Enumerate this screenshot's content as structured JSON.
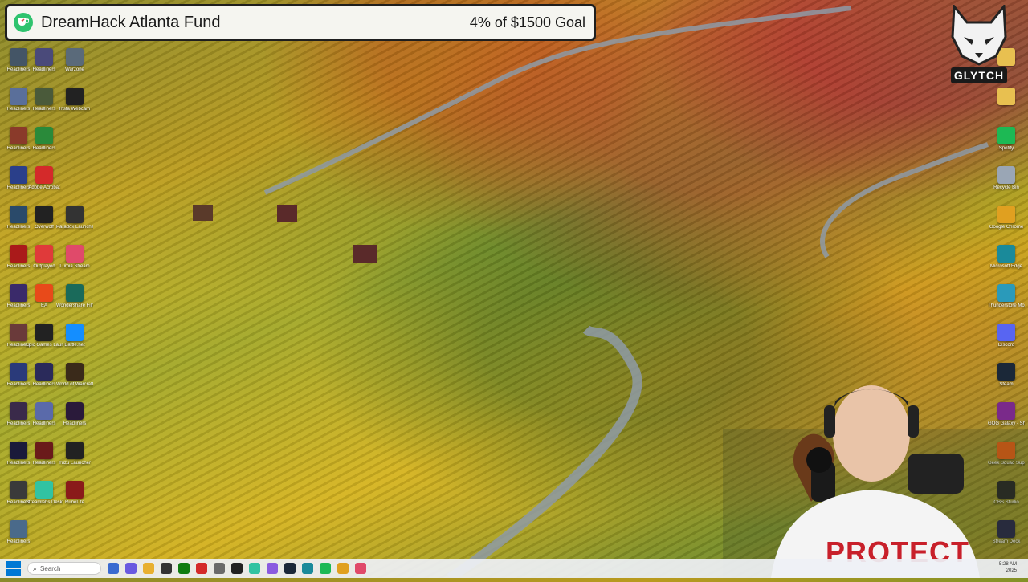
{
  "donation": {
    "title": "DreamHack Atlanta Fund",
    "goal_text": "4% of $1500 Goal"
  },
  "logo": {
    "text": "GLYTCH"
  },
  "desktop_left_col1": [
    {
      "label": "Headliners",
      "icon": "headliners-icon",
      "color": "#445566"
    },
    {
      "label": "Headliners",
      "icon": "headliners-icon",
      "color": "#5a6f9a"
    },
    {
      "label": "Headliners",
      "icon": "headliners-icon",
      "color": "#8a3a2a"
    },
    {
      "label": "Headliners",
      "icon": "headliners-icon",
      "color": "#2a3f8a"
    },
    {
      "label": "Headliners",
      "icon": "headliners-icon",
      "color": "#2a4a6a"
    },
    {
      "label": "Headliners",
      "icon": "headliners-icon",
      "color": "#aa1a1a"
    },
    {
      "label": "Headliners",
      "icon": "headliners-icon",
      "color": "#3a2a6a"
    },
    {
      "label": "Headliners",
      "icon": "headliners-icon",
      "color": "#6a3a3a"
    },
    {
      "label": "Headliners",
      "icon": "headliners-icon",
      "color": "#2a3a7a"
    },
    {
      "label": "Headliners",
      "icon": "headliners-icon",
      "color": "#3a2a4a"
    },
    {
      "label": "Headliners",
      "icon": "headliners-icon",
      "color": "#1a1a3a"
    },
    {
      "label": "Headliners",
      "icon": "headliners-icon",
      "color": "#3a3a3a"
    },
    {
      "label": "Headliners",
      "icon": "headliners-icon",
      "color": "#4a6a8a"
    }
  ],
  "desktop_left_col2": [
    {
      "label": "Headliners",
      "icon": "headliners-icon",
      "color": "#4a4a7a"
    },
    {
      "label": "Headliners",
      "icon": "headliners-icon",
      "color": "#4a5a3a"
    },
    {
      "label": "Headliners",
      "icon": "headliners-icon",
      "color": "#2a8a3a"
    },
    {
      "label": "Adobe Acrobat",
      "icon": "acrobat-icon",
      "color": "#d42a2a"
    },
    {
      "label": "Overwolf",
      "icon": "overwolf-icon",
      "color": "#222222"
    },
    {
      "label": "Outplayed",
      "icon": "outplayed-icon",
      "color": "#e03a3a"
    },
    {
      "label": "EA",
      "icon": "ea-icon",
      "color": "#e84a1a"
    },
    {
      "label": "Epic Games Launcher",
      "icon": "epic-games-icon",
      "color": "#222222"
    },
    {
      "label": "Headliners",
      "icon": "headliners-icon",
      "color": "#2a2a5a"
    },
    {
      "label": "Headliners",
      "icon": "headliners-icon",
      "color": "#5a6aaa"
    },
    {
      "label": "Headliners",
      "icon": "headliners-icon",
      "color": "#6a1a1a"
    },
    {
      "label": "Streamlabs Desktop",
      "icon": "streamlabs-icon",
      "color": "#31c3a2"
    }
  ],
  "desktop_left_col3": [
    {
      "label": "Warzone",
      "icon": "warzone-icon",
      "color": "#5a6a7a"
    },
    {
      "label": "Insta Webcam",
      "icon": "webcam-icon",
      "color": "#222222"
    },
    {
      "label": "",
      "icon": "blank-icon",
      "color": "transparent"
    },
    {
      "label": "",
      "icon": "blank-icon",
      "color": "transparent"
    },
    {
      "label": "Paradox Launcher",
      "icon": "paradox-icon",
      "color": "#333333"
    },
    {
      "label": "Lumia Stream",
      "icon": "lumia-icon",
      "color": "#e04a6a"
    },
    {
      "label": "Wondershare Filmora",
      "icon": "filmora-icon",
      "color": "#1a6a5a"
    },
    {
      "label": "Battle.net",
      "icon": "battlenet-icon",
      "color": "#148eff"
    },
    {
      "label": "World of Warcraft",
      "icon": "wow-icon",
      "color": "#3a2a1a"
    },
    {
      "label": "Headliners",
      "icon": "headliners-icon",
      "color": "#2a1a3a"
    },
    {
      "label": "Yuzu Launcher",
      "icon": "yuzu-icon",
      "color": "#222222"
    },
    {
      "label": "RuneLite",
      "icon": "runelite-icon",
      "color": "#8a1a1a"
    }
  ],
  "desktop_right_col": [
    {
      "label": "",
      "icon": "folder-icon",
      "color": "#e8c050"
    },
    {
      "label": "",
      "icon": "folder-icon",
      "color": "#e8c050"
    },
    {
      "label": "Spotify",
      "icon": "spotify-icon",
      "color": "#1db954"
    },
    {
      "label": "Recycle Bin",
      "icon": "recycle-bin-icon",
      "color": "#9aa6b5"
    },
    {
      "label": "Google Chrome",
      "icon": "chrome-icon",
      "color": "#e0a020"
    },
    {
      "label": "Microsoft Edge",
      "icon": "edge-icon",
      "color": "#1a8a9a"
    },
    {
      "label": "Thunderstore Mod Manager",
      "icon": "thunderstore-icon",
      "color": "#2a9aba"
    },
    {
      "label": "Discord",
      "icon": "discord-icon",
      "color": "#5865f2"
    },
    {
      "label": "Steam",
      "icon": "steam-icon",
      "color": "#1b2838"
    },
    {
      "label": "GOG Galaxy - Shortcut",
      "icon": "gog-icon",
      "color": "#7a2a8a"
    },
    {
      "label": "Geek Squad Support.exe",
      "icon": "geek-squad-icon",
      "color": "#e05a10"
    },
    {
      "label": "OBS Studio",
      "icon": "obs-icon",
      "color": "#222222"
    },
    {
      "label": "Stream Deck",
      "icon": "stream-deck-icon",
      "color": "#222244"
    }
  ],
  "taskbar": {
    "search_placeholder": "Search",
    "apps": [
      {
        "icon": "widgets-icon",
        "color": "#3a6ad0"
      },
      {
        "icon": "copilot-icon",
        "color": "#6a5ae0"
      },
      {
        "icon": "file-explorer-icon",
        "color": "#e8b030"
      },
      {
        "icon": "terminal-icon",
        "color": "#333333"
      },
      {
        "icon": "xbox-icon",
        "color": "#107c10"
      },
      {
        "icon": "acrobat-icon",
        "color": "#d42a2a"
      },
      {
        "icon": "settings-icon",
        "color": "#6a6a6a"
      },
      {
        "icon": "obs-icon",
        "color": "#222222"
      },
      {
        "icon": "streamlabs-icon",
        "color": "#31c3a2"
      },
      {
        "icon": "snipping-icon",
        "color": "#8a5ae0"
      },
      {
        "icon": "steam-icon",
        "color": "#1b2838"
      },
      {
        "icon": "edge-icon",
        "color": "#1a8a9a"
      },
      {
        "icon": "spotify-icon",
        "color": "#1db954"
      },
      {
        "icon": "chrome-icon",
        "color": "#e0a020"
      },
      {
        "icon": "lumia-icon",
        "color": "#e04a6a"
      }
    ],
    "clock_time": "5:28 AM",
    "clock_date": "2025"
  },
  "webcam": {
    "shirt_text": "PROTECT"
  }
}
